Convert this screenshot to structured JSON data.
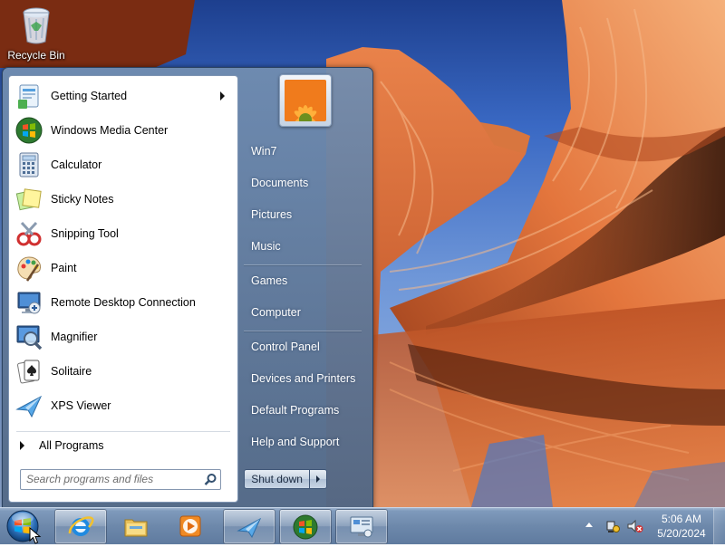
{
  "desktop": {
    "icons": [
      {
        "label": "Recycle Bin",
        "icon": "recycle-bin-icon"
      }
    ]
  },
  "start_menu": {
    "programs": [
      {
        "label": "Getting Started",
        "icon": "getting-started-icon",
        "has_submenu": true
      },
      {
        "label": "Windows Media Center",
        "icon": "media-center-icon"
      },
      {
        "label": "Calculator",
        "icon": "calculator-icon"
      },
      {
        "label": "Sticky Notes",
        "icon": "sticky-notes-icon"
      },
      {
        "label": "Snipping Tool",
        "icon": "snipping-tool-icon"
      },
      {
        "label": "Paint",
        "icon": "paint-icon"
      },
      {
        "label": "Remote Desktop Connection",
        "icon": "remote-desktop-icon"
      },
      {
        "label": "Magnifier",
        "icon": "magnifier-icon"
      },
      {
        "label": "Solitaire",
        "icon": "solitaire-icon"
      },
      {
        "label": "XPS Viewer",
        "icon": "xps-viewer-icon"
      }
    ],
    "all_programs": "All Programs",
    "search_placeholder": "Search programs and files",
    "right_items": [
      {
        "label": "Win7"
      },
      {
        "label": "Documents"
      },
      {
        "label": "Pictures"
      },
      {
        "label": "Music"
      },
      {
        "label": "Games"
      },
      {
        "label": "Computer"
      },
      {
        "label": "Control Panel"
      },
      {
        "label": "Devices and Printers"
      },
      {
        "label": "Default Programs"
      },
      {
        "label": "Help and Support"
      }
    ],
    "shutdown_label": "Shut down"
  },
  "taskbar": {
    "pinned": [
      {
        "icon": "internet-explorer-icon"
      },
      {
        "icon": "windows-explorer-icon"
      },
      {
        "icon": "media-player-icon"
      },
      {
        "icon": "xps-viewer-icon"
      },
      {
        "icon": "media-center-icon"
      },
      {
        "icon": "remote-desktop-icon"
      }
    ],
    "clock_time": "5:06 AM",
    "clock_date": "5/20/2024"
  },
  "colors": {
    "taskbar": "#6d88ab",
    "start_menu_frame": "#5e7696",
    "wallpaper_rock": "#e0703a",
    "wallpaper_sky": "#2f5fb8"
  }
}
